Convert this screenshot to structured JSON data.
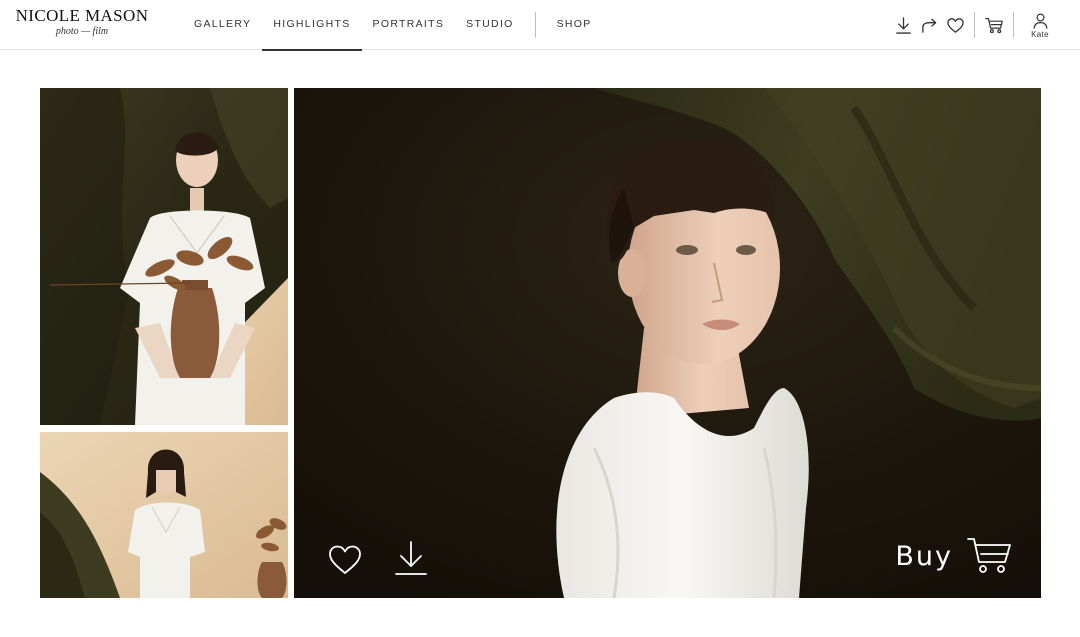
{
  "brand": {
    "name": "NICOLE MASON",
    "tagline": "photo — film"
  },
  "nav": {
    "items": [
      {
        "label": "GALLERY",
        "active": false
      },
      {
        "label": "HIGHLIGHTS",
        "active": true
      },
      {
        "label": "PORTRAITS",
        "active": false
      },
      {
        "label": "STUDIO",
        "active": false
      },
      {
        "label": "SHOP",
        "active": false
      }
    ]
  },
  "toolbar": {
    "icons": [
      "download-icon",
      "share-icon",
      "heart-icon",
      "cart-icon",
      "user-icon"
    ],
    "user_name": "Kate"
  },
  "viewer": {
    "buy_label": "Buy",
    "overlay_icons": [
      "heart-icon",
      "download-icon",
      "cart-icon"
    ]
  },
  "colors": {
    "backdrop_dark": "#1c140c",
    "backdrop_olive": "#3b3a1e",
    "plywood": "#e2c8a6",
    "dress": "#f4f2ee",
    "nav_text": "#333333"
  }
}
